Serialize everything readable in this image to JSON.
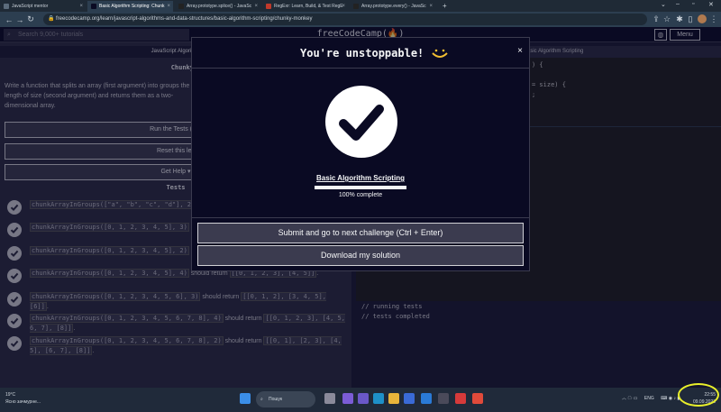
{
  "browser": {
    "tabs": [
      {
        "title": "JavaScript mentor",
        "active": false,
        "favicon_color": "#5b6b7b"
      },
      {
        "title": "Basic Algorithm Scripting: Chunk",
        "active": true,
        "favicon_color": "#0a0a23"
      },
      {
        "title": "Array.prototype.splice() - JavaSc",
        "active": false,
        "favicon_color": "#222"
      },
      {
        "title": "RegExr: Learn, Build, & Test RegE",
        "active": false,
        "favicon_color": "#c0392b"
      },
      {
        "title": "Array.prototype.every() - JavaSc",
        "active": false,
        "favicon_color": "#222"
      }
    ],
    "new_tab": "+",
    "url": "freecodecamp.org/learn/javascript-algorithms-and-data-structures/basic-algorithm-scripting/chunky-monkey"
  },
  "fcc_nav": {
    "search_placeholder": "Search 9,000+ tutorials",
    "logo": "freeCodeCamp(🔥)",
    "menu_label": "Menu"
  },
  "left": {
    "breadcrumb": "JavaScript Algorithm",
    "challenge_title": "Chunky Monke",
    "description": "Write a function that splits an array (first argument) into groups the length of size (second argument) and returns them as a two-dimensional array.",
    "run_button": "Run the Tests (Ctrl",
    "reset_button": "Reset this les",
    "help_button": "Get Help ▾",
    "tests_heading": "Tests",
    "tests": [
      {
        "code": "chunkArrayInGroups([\"a\", \"b\", \"c\", \"d\"], 2)",
        "mid": "",
        "result": ""
      },
      {
        "code": "chunkArrayInGroups([0, 1, 2, 3, 4, 5], 3)",
        "mid": "",
        "result": ""
      },
      {
        "code": "chunkArrayInGroups([0, 1, 2, 3, 4, 5], 2)",
        "mid": "",
        "result": ""
      },
      {
        "code": "chunkArrayInGroups([0, 1, 2, 3, 4, 5], 4)",
        "mid": " should return ",
        "result": "[[0, 1, 2, 3], [4, 5]]"
      },
      {
        "code": "chunkArrayInGroups([0, 1, 2, 3, 4, 5, 6], 3)",
        "mid": " should return ",
        "result": "[[0, 1, 2], [3, 4, 5], [6]]"
      },
      {
        "code": "chunkArrayInGroups([0, 1, 2, 3, 4, 5, 6, 7, 8], 4)",
        "mid": " should return ",
        "result": "[[0, 1, 2, 3], [4, 5, 6, 7], [8]]"
      },
      {
        "code": "chunkArrayInGroups([0, 1, 2, 3, 4, 5, 6, 7, 8], 2)",
        "mid": " should return ",
        "result": "[[0, 1], [2, 3], [4, 5], [6, 7], [8]]"
      }
    ]
  },
  "right": {
    "header": "asic Algorithm Scripting",
    "editor_lines": [
      ") {",
      "",
      "= size) {",
      ";"
    ],
    "console_lines": [
      "// running tests",
      "// tests completed"
    ]
  },
  "modal": {
    "title": "You're unstoppable!",
    "close": "×",
    "cert_title": "Basic Algorithm Scripting",
    "progress_value": 1.0,
    "progress_text": "100% complete",
    "submit_button": "Submit and go to next challenge (Ctrl + Enter)",
    "download_button": "Download my solution"
  },
  "taskbar": {
    "weather_temp": "19°C",
    "weather_desc": "Ясно зачмурне...",
    "search_label": "Пошук",
    "lang": "ENG",
    "time": "22:55",
    "date": "09.09.2023"
  }
}
